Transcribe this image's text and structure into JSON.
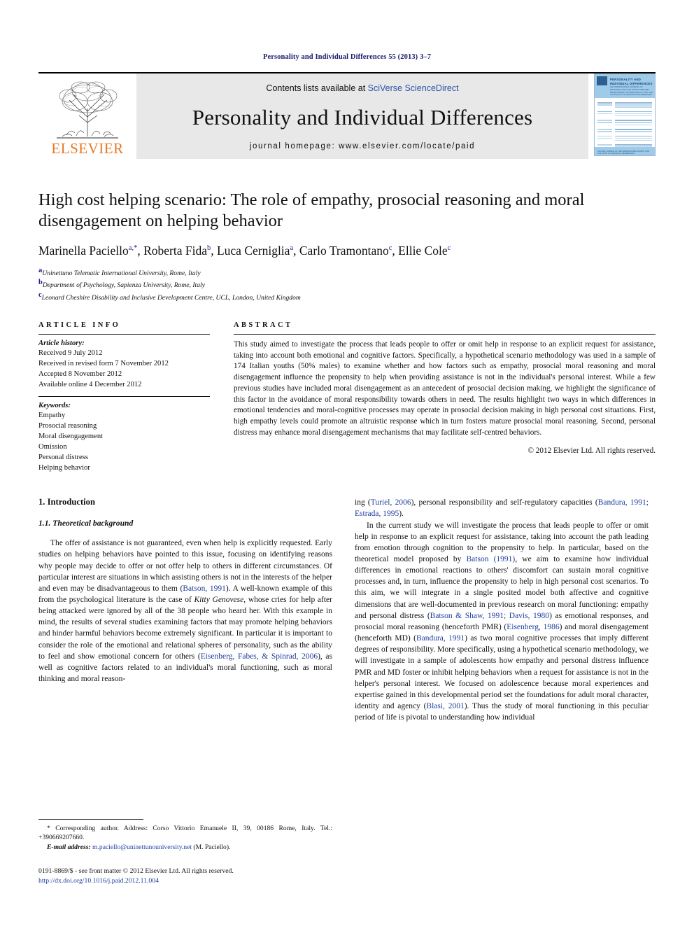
{
  "running_head": "Personality and Individual Differences 55 (2013) 3–7",
  "masthead": {
    "publisher": "ELSEVIER",
    "contents_prefix": "Contents lists available at ",
    "contents_link": "SciVerse ScienceDirect",
    "journal_title": "Personality and Individual Differences",
    "homepage": "journal homepage: www.elsevier.com/locate/paid",
    "cover": {
      "title": "PERSONALITY AND INDIVIDUAL DIFFERENCES",
      "subtitle": "AN INTERNATIONAL JOURNAL OF RESEARCH INTO THE STRUCTURE AND DEVELOPMENT OF PERSONALITY AND THE CAUSATION OF INDIVIDUAL DIFFERENCES",
      "footer": "OFFICIAL JOURNAL OF THE INTERNATIONAL SOCIETY FOR THE STUDY OF INDIVIDUAL DIFFERENCES"
    }
  },
  "article": {
    "title": "High cost helping scenario: The role of empathy, prosocial reasoning and moral disengagement on helping behavior",
    "authors": [
      {
        "name": "Marinella Paciello",
        "marks": "a,*"
      },
      {
        "name": "Roberta Fida",
        "marks": "b"
      },
      {
        "name": "Luca Cerniglia",
        "marks": "a"
      },
      {
        "name": "Carlo Tramontano",
        "marks": "c"
      },
      {
        "name": "Ellie Cole",
        "marks": "c"
      }
    ],
    "affiliations": [
      {
        "mark": "a",
        "text": "Uninettuno Telematic International University, Rome, Italy"
      },
      {
        "mark": "b",
        "text": "Department of Psychology, Sapienza University, Rome, Italy"
      },
      {
        "mark": "c",
        "text": "Leonard Cheshire Disability and Inclusive Development Centre, UCL, London, United Kingdom"
      }
    ]
  },
  "article_info": {
    "heading": "ARTICLE INFO",
    "history_label": "Article history:",
    "history": [
      "Received 9 July 2012",
      "Received in revised form 7 November 2012",
      "Accepted 8 November 2012",
      "Available online 4 December 2012"
    ],
    "keywords_label": "Keywords:",
    "keywords": [
      "Empathy",
      "Prosocial reasoning",
      "Moral disengagement",
      "Omission",
      "Personal distress",
      "Helping behavior"
    ]
  },
  "abstract": {
    "heading": "ABSTRACT",
    "text": "This study aimed to investigate the process that leads people to offer or omit help in response to an explicit request for assistance, taking into account both emotional and cognitive factors. Specifically, a hypothetical scenario methodology was used in a sample of 174 Italian youths (50% males) to examine whether and how factors such as empathy, prosocial moral reasoning and moral disengagement influence the propensity to help when providing assistance is not in the individual's personal interest. While a few previous studies have included moral disengagement as an antecedent of prosocial decision making, we highlight the significance of this factor in the avoidance of moral responsibility towards others in need. The results highlight two ways in which differences in emotional tendencies and moral-cognitive processes may operate in prosocial decision making in high personal cost situations. First, high empathy levels could promote an altruistic response which in turn fosters mature prosocial moral reasoning. Second, personal distress may enhance moral disengagement mechanisms that may facilitate self-centred behaviors.",
    "copyright": "© 2012 Elsevier Ltd. All rights reserved."
  },
  "body": {
    "section_heading": "1. Introduction",
    "subsection_heading": "1.1. Theoretical background",
    "left_paragraph_1": {
      "part1": "The offer of assistance is not guaranteed, even when help is explicitly requested. Early studies on helping behaviors have pointed to this issue, focusing on identifying reasons why people may decide to offer or not offer help to others in different circumstances. Of particular interest are situations in which assisting others is not in the interests of the helper and even may be disadvantageous to them (",
      "cite1": "Batson, 1991",
      "part2": "). A well-known example of this from the psychological literature is the case of ",
      "italic1": "Kitty Genovese",
      "part3": ", whose cries for help after being attacked were ignored by all of the 38 people who heard her. With this example in mind, the results of several studies examining factors that may promote helping behaviors and hinder harmful behaviors become extremely significant. In particular it is important to consider the role of the emotional and relational spheres of personality, such as the ability to feel and show emotional concern for others (",
      "cite2": "Eisenberg, Fabes, & Spinrad, 2006",
      "part4": "), as well as cognitive factors related to an individual's moral functioning, such as moral thinking and moral reason-"
    },
    "right_paragraph_1": {
      "part1": "ing (",
      "cite1": "Turiel, 2006",
      "part2": "), personal responsibility and self-regulatory capacities (",
      "cite2": "Bandura, 1991; Estrada, 1995",
      "part3": ")."
    },
    "right_paragraph_2": {
      "part1": "In the current study we will investigate the process that leads people to offer or omit help in response to an explicit request for assistance, taking into account the path leading from emotion through cognition to the propensity to help. In particular, based on the theoretical model proposed by ",
      "cite1": "Batson (1991)",
      "part2": ", we aim to examine how individual differences in emotional reactions to others' discomfort can sustain moral cognitive processes and, in turn, influence the propensity to help in high personal cost scenarios. To this aim, we will integrate in a single posited model both affective and cognitive dimensions that are well-documented in previous research on moral functioning: empathy and personal distress (",
      "cite2": "Batson & Shaw, 1991; Davis, 1980",
      "part3": ") as emotional responses, and prosocial moral reasoning (henceforth PMR) (",
      "cite3": "Eisenberg, 1986",
      "part4": ") and moral disengagement (henceforth MD) (",
      "cite4": "Bandura, 1991",
      "part5": ") as two moral cognitive processes that imply different degrees of responsibility. More specifically, using a hypothetical scenario methodology, we will investigate in a sample of adolescents how empathy and personal distress influence PMR and MD foster or inhibit helping behaviors when a request for assistance is not in the helper's personal interest. We focused on adolescence because moral experiences and expertise gained in this developmental period set the foundations for adult moral character, identity and agency (",
      "cite5": "Blasi, 2001",
      "part6": "). Thus the study of moral functioning in this peculiar period of life is pivotal to understanding how individual"
    }
  },
  "footnotes": {
    "corresponding": "* Corresponding author. Address: Corso Vittorio Emanuele II, 39, 00186 Rome, Italy. Tel.: +390669207660.",
    "email_label": "E-mail address:",
    "email": "m.paciello@uninettunouniversity.net",
    "email_suffix": "(M. Paciello)."
  },
  "footer": {
    "issn_line": "0191-8869/$ - see front matter © 2012 Elsevier Ltd. All rights reserved.",
    "doi": "http://dx.doi.org/10.1016/j.paid.2012.11.004"
  },
  "colors": {
    "link_blue": "#1f3f9e",
    "runhead_blue": "#1a1a6e",
    "elsevier_orange": "#e87722",
    "masthead_grey": "#e8e8e8",
    "cover_blue": "#9fcbe8"
  }
}
